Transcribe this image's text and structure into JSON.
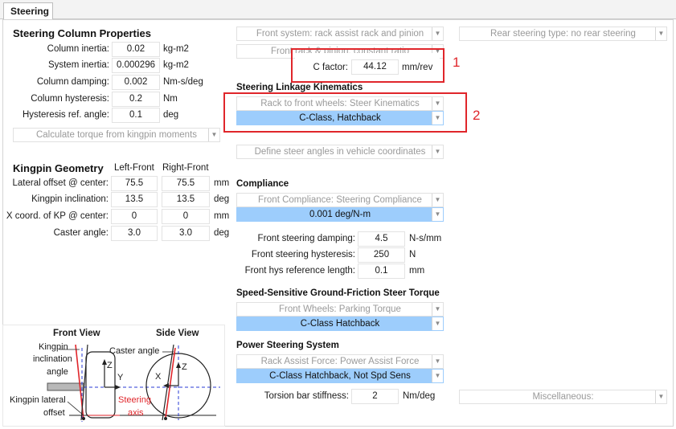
{
  "tabs": [
    {
      "label": "Steering"
    }
  ],
  "steering_column": {
    "title": "Steering Column Properties",
    "rows": [
      {
        "label": "Column inertia:",
        "value": "0.02",
        "unit": "kg-m2"
      },
      {
        "label": "System inertia:",
        "value": "0.000296",
        "unit": "kg-m2"
      },
      {
        "label": "Column damping:",
        "value": "0.002",
        "unit": "Nm-s/deg"
      },
      {
        "label": "Column hysteresis:",
        "value": "0.2",
        "unit": "Nm"
      },
      {
        "label": "Hysteresis ref. angle:",
        "value": "0.1",
        "unit": "deg"
      }
    ],
    "torque_dropdown": "Calculate torque from kingpin moments"
  },
  "kingpin": {
    "title": "Kingpin Geometry",
    "col_left": "Left-Front",
    "col_right": "Right-Front",
    "rows": [
      {
        "label": "Lateral offset @ center:",
        "left": "75.5",
        "right": "75.5",
        "unit": "mm"
      },
      {
        "label": "Kingpin inclination:",
        "left": "13.5",
        "right": "13.5",
        "unit": "deg"
      },
      {
        "label": "X coord. of KP @ center:",
        "left": "0",
        "right": "0",
        "unit": "mm"
      },
      {
        "label": "Caster angle:",
        "left": "3.0",
        "right": "3.0",
        "unit": "deg"
      }
    ]
  },
  "front_system": {
    "dropdown": "Front system: rack assist rack and pinion",
    "rack_dropdown": "Front rack & pinion: constant ratio",
    "c_factor_label": "C factor:",
    "c_factor_value": "44.12",
    "c_factor_unit": "mm/rev"
  },
  "rear": {
    "dropdown": "Rear steering type: no rear steering"
  },
  "linkage": {
    "title": "Steering Linkage Kinematics",
    "dropdown": "Rack to front wheels: Steer Kinematics",
    "selected": "C-Class, Hatchback",
    "define_dropdown": "Define steer angles in vehicle coordinates"
  },
  "compliance": {
    "title": "Compliance",
    "dropdown": "Front Compliance: Steering Compliance",
    "selected": "0.001 deg/N-m",
    "rows": [
      {
        "label": "Front steering damping:",
        "value": "4.5",
        "unit": "N-s/mm"
      },
      {
        "label": "Front steering hysteresis:",
        "value": "250",
        "unit": "N"
      },
      {
        "label": "Front hys reference length:",
        "value": "0.1",
        "unit": "mm"
      }
    ]
  },
  "speed_sensitive": {
    "title": "Speed-Sensitive Ground-Friction Steer Torque",
    "dropdown": "Front Wheels: Parking Torque",
    "selected": "C-Class Hatchback"
  },
  "power_steering": {
    "title": "Power Steering System",
    "dropdown": "Rack Assist Force: Power Assist Force",
    "selected": "C-Class Hatchback, Not Spd Sens",
    "torsion_label": "Torsion bar stiffness:",
    "torsion_value": "2",
    "torsion_unit": "Nm/deg"
  },
  "misc": {
    "dropdown": "Miscellaneous:"
  },
  "annotations": {
    "one": "1",
    "two": "2",
    "color": "#e0262b"
  },
  "diagram": {
    "front_view": "Front View",
    "side_view": "Side View",
    "kingpin_incl_1": "Kingpin",
    "kingpin_incl_2": "inclination",
    "kingpin_incl_3": "angle",
    "caster_angle": "Caster angle",
    "lateral_1": "Kingpin lateral",
    "lateral_2": "offset",
    "steering_1": "Steering",
    "steering_2": "axis",
    "z1": "Z",
    "y1": "Y",
    "z2": "Z",
    "x2": "X"
  }
}
